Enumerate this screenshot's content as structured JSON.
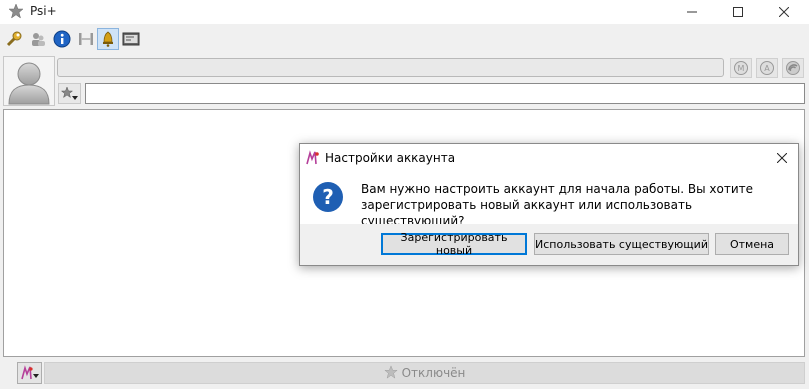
{
  "window": {
    "title": "Psi+",
    "icon": "psi-star-icon"
  },
  "toolbar": {
    "items": [
      "wrench-icon",
      "users-icon",
      "info-icon",
      "bridge-icon",
      "bell-icon",
      "terminal-icon"
    ]
  },
  "status": {
    "text": "",
    "message_value": "",
    "icons": [
      "mood-icon",
      "activity-icon",
      "tune-icon"
    ]
  },
  "bottom": {
    "account_icon": "psi-account-icon",
    "status_label": "Отключён"
  },
  "dialog": {
    "title": "Настройки аккаунта",
    "message": "Вам нужно настроить аккаунт для начала работы. Вы хотите зарегистрировать новый аккаунт или использовать существующий?",
    "buttons": {
      "register": "Зарегистрировать новый",
      "use_existing": "Использовать существующий",
      "cancel": "Отмена"
    }
  },
  "colors": {
    "accent": "#0078d7",
    "question": "#1f5fb3"
  }
}
